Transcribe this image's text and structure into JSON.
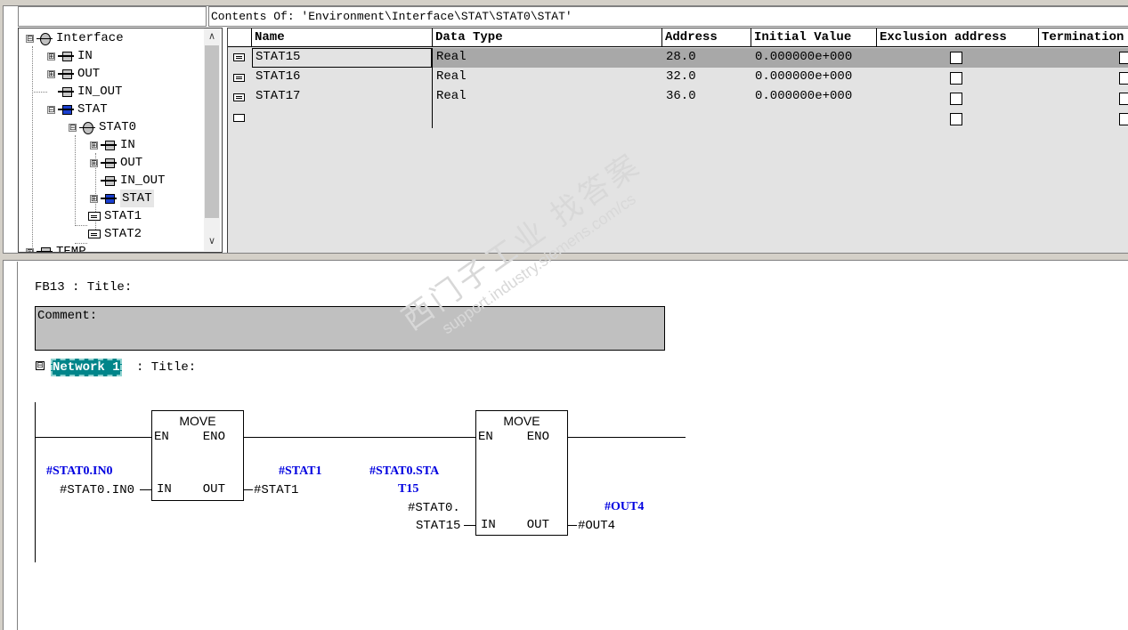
{
  "contents_header": "Contents Of: 'Environment\\Interface\\STAT\\STAT0\\STAT'",
  "tree": {
    "items": [
      {
        "label": "Interface",
        "expander": "⊟"
      },
      {
        "label": "IN",
        "expander": "⊞"
      },
      {
        "label": "OUT",
        "expander": "⊞"
      },
      {
        "label": "IN_OUT",
        "expander": ""
      },
      {
        "label": "STAT",
        "expander": "⊟"
      },
      {
        "label": "STAT0",
        "expander": "⊟"
      },
      {
        "label": "IN",
        "expander": "⊞"
      },
      {
        "label": "OUT",
        "expander": "⊞"
      },
      {
        "label": "IN_OUT",
        "expander": ""
      },
      {
        "label": "STAT",
        "expander": "⊞"
      },
      {
        "label": "STAT1",
        "expander": ""
      },
      {
        "label": "STAT2",
        "expander": ""
      },
      {
        "label": "TEMP",
        "expander": "⊞"
      }
    ],
    "scroll_up": "∧",
    "scroll_down": "∨"
  },
  "table": {
    "headers": [
      "Name",
      "Data Type",
      "Address",
      "Initial Value",
      "Exclusion address",
      "Termination"
    ],
    "rows": [
      {
        "name": "STAT15",
        "type": "Real",
        "address": "28.0",
        "initial": "0.000000e+000"
      },
      {
        "name": "STAT16",
        "type": "Real",
        "address": "32.0",
        "initial": "0.000000e+000"
      },
      {
        "name": "STAT17",
        "type": "Real",
        "address": "36.0",
        "initial": "0.000000e+000"
      },
      {
        "name": "",
        "type": "",
        "address": "",
        "initial": ""
      }
    ]
  },
  "editor": {
    "block_title": "FB13 : Title:",
    "comment_label": "Comment:",
    "network_collapse": "⊟",
    "network_label": "Network 1",
    "network_title": ": Title:",
    "box1": {
      "title": "MOVE",
      "en": "EN",
      "eno": "ENO",
      "in": "IN",
      "out": "OUT",
      "in_symbol": "#STAT0.IN0",
      "in_operand": "#STAT0.IN0",
      "out_symbol": "#STAT1",
      "out_operand": "#STAT1"
    },
    "box2": {
      "title": "MOVE",
      "en": "EN",
      "eno": "ENO",
      "in": "IN",
      "out": "OUT",
      "in_symbol_line1": "#STAT0.STA",
      "in_symbol_line2": "T15",
      "in_operand_line1": "#STAT0.",
      "in_operand_line2": "STAT15",
      "out_symbol": "#OUT4",
      "out_operand": "#OUT4"
    }
  },
  "watermark": {
    "line1": "西门子工业  找答案",
    "line2": "support.industry.siemens.com/cs"
  },
  "colors": {
    "network_label_bg": "#00858a",
    "symbol_blue": "#0000e0",
    "selected_row": "#a8a8a8",
    "comment_bg": "#c0c0c0"
  }
}
